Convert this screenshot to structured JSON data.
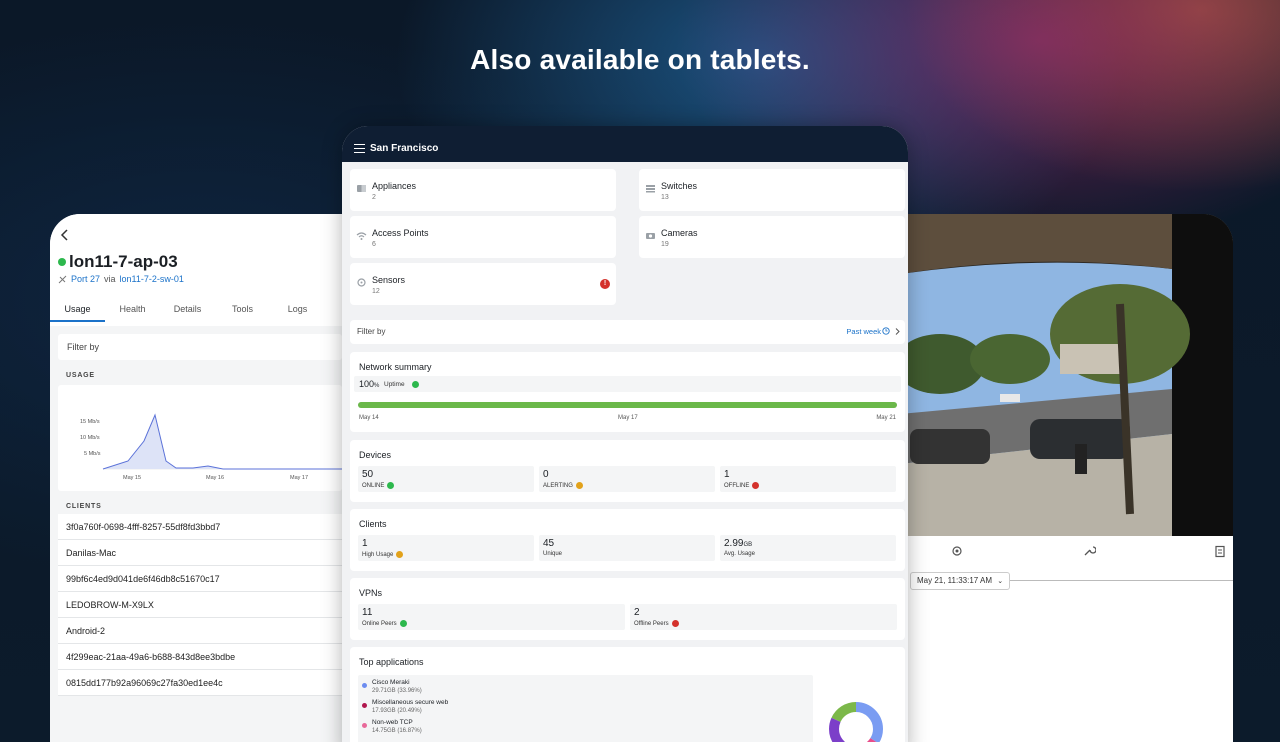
{
  "headline": "Also available on tablets.",
  "left_tablet": {
    "device_name": "lon11-7-ap-03",
    "port": "Port 27",
    "via": "via",
    "switch": "lon11-7-2-sw-01",
    "tabs": [
      "Usage",
      "Health",
      "Details",
      "Tools",
      "Logs"
    ],
    "filter_label": "Filter by",
    "usage_heading": "USAGE",
    "usage_chart": {
      "y_ticks": [
        "15 Mb/s",
        "10 Mb/s",
        "5 Mb/s"
      ],
      "x_ticks": [
        "May 15",
        "May 16",
        "May 17"
      ]
    },
    "clients_heading": "CLIENTS",
    "clients": [
      "3f0a760f-0698-4fff-8257-55df8fd3bbd7",
      "Danilas-Mac",
      "99bf6c4ed9d041de6f46db8c51670c17",
      "LEDOBROW-M-X9LX",
      "Android-2",
      "4f299eac-21aa-49a6-b688-843d8ee3bdbe",
      "0815dd177b92a96069c27fa30ed1ee4c"
    ]
  },
  "center_tablet": {
    "network_name": "San Francisco",
    "categories": [
      {
        "name": "Appliances",
        "count": "2",
        "icon": "appliance-icon"
      },
      {
        "name": "Switches",
        "count": "13",
        "icon": "switch-icon"
      },
      {
        "name": "Access Points",
        "count": "6",
        "icon": "wifi-icon"
      },
      {
        "name": "Cameras",
        "count": "19",
        "icon": "camera-icon"
      },
      {
        "name": "Sensors",
        "count": "12",
        "icon": "sensor-icon",
        "alert": "!"
      }
    ],
    "filter": {
      "label": "Filter by",
      "value": "Past week"
    },
    "network_summary": {
      "title": "Network summary",
      "uptime_value": "100",
      "uptime_unit": "%",
      "uptime_label": "Uptime",
      "uptime_fraction": 1.0,
      "dates": [
        "May 14",
        "May 17",
        "May 21"
      ]
    },
    "devices": {
      "title": "Devices",
      "stats": [
        {
          "value": "50",
          "label": "ONLINE",
          "status": "ok"
        },
        {
          "value": "0",
          "label": "ALERTING",
          "status": "warn"
        },
        {
          "value": "1",
          "label": "OFFLINE",
          "status": "bad"
        }
      ]
    },
    "clients": {
      "title": "Clients",
      "stats": [
        {
          "value": "1",
          "unit": "",
          "label": "High Usage",
          "status": "warn"
        },
        {
          "value": "45",
          "unit": "",
          "label": "Unique",
          "status": ""
        },
        {
          "value": "2.99",
          "unit": "GB",
          "label": "Avg. Usage",
          "status": ""
        }
      ]
    },
    "vpns": {
      "title": "VPNs",
      "stats": [
        {
          "value": "11",
          "label": "Online Peers",
          "status": "ok"
        },
        {
          "value": "2",
          "label": "Offline Peers",
          "status": "bad"
        }
      ]
    },
    "top_applications": {
      "title": "Top applications",
      "items": [
        {
          "name": "Cisco Meraki",
          "detail": "29.71GB (33.96%)",
          "color": "#6c8cf0"
        },
        {
          "name": "Miscellaneous secure web",
          "detail": "17.93GB (20.49%)",
          "color": "#b0174e"
        },
        {
          "name": "Non-web TCP",
          "detail": "14.75GB (16.87%)",
          "color": "#e8699a"
        }
      ],
      "donut_colors": [
        "#7a9cf2",
        "#e84d8a",
        "#7c3fc9",
        "#7cb84a"
      ]
    }
  },
  "right_tablet": {
    "timestamp": "May 21, 11:33:17 AM"
  }
}
